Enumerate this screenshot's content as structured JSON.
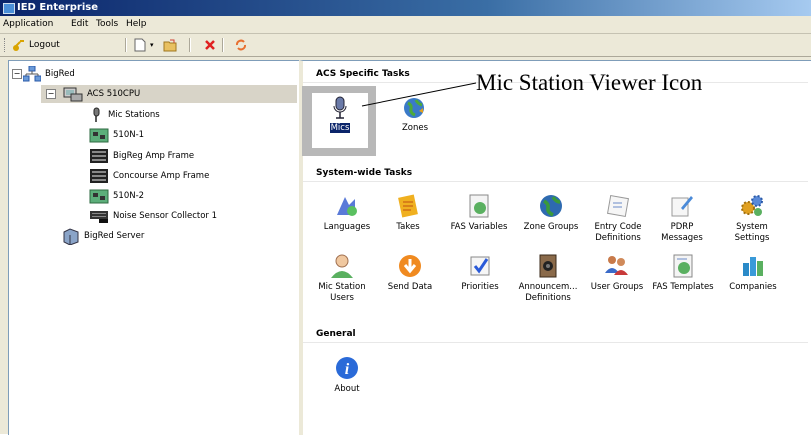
{
  "window": {
    "title": "IED Enterprise"
  },
  "menu": [
    "Application",
    "Edit",
    "Tools",
    "Help"
  ],
  "toolbar": {
    "logout_label": "Logout"
  },
  "tree": {
    "root": "BigRed",
    "device": "ACS 510CPU",
    "children": [
      "Mic Stations",
      "510N-1",
      "BigReg Amp Frame",
      "Concourse Amp Frame",
      "510N-2",
      "Noise Sensor Collector 1"
    ],
    "server": "BigRed Server"
  },
  "acs_tasks": {
    "heading": "ACS Specific Tasks",
    "items": [
      "Mics",
      "Zones"
    ]
  },
  "system_tasks": {
    "heading": "System-wide Tasks",
    "row1": [
      [
        "Languages"
      ],
      [
        "Takes"
      ],
      [
        "FAS Variables"
      ],
      [
        "Zone Groups"
      ],
      [
        "Entry Code",
        "Definitions"
      ],
      [
        "PDRP",
        "Messages"
      ],
      [
        "System",
        "Settings"
      ]
    ],
    "row2": [
      [
        "Mic Station",
        "Users"
      ],
      [
        "Send Data"
      ],
      [
        "Priorities"
      ],
      [
        "Announcem...",
        "Definitions"
      ],
      [
        "User Groups"
      ],
      [
        "FAS Templates"
      ],
      [
        "Companies"
      ]
    ]
  },
  "general": {
    "heading": "General",
    "about": "About"
  },
  "annotation": "Mic Station Viewer Icon"
}
